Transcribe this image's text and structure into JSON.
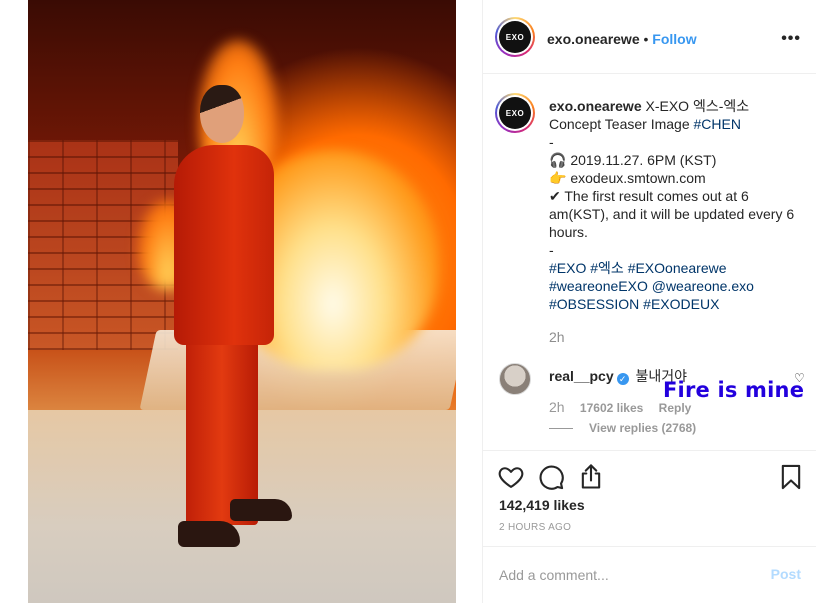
{
  "post": {
    "username": "exo.onearewe",
    "follow_label": "Follow",
    "separator": "•",
    "more_label": "•••",
    "avatar_text": "EXO"
  },
  "caption": {
    "username": "exo.onearewe",
    "line1": " X-EXO 엑스-엑소 Concept Teaser Image ",
    "tag_chen": "#CHEN",
    "dash1": "-",
    "line_date": "🎧 2019.11.27. 6PM (KST)",
    "line_site": "👉 exodeux.smtown.com",
    "line_result": "✔ The first result comes out at 6 am(KST), and it will be updated every 6 hours.",
    "dash2": "-",
    "tag_exo": "#EXO",
    "tag_kr": "#엑소",
    "tag_onearewe": "#EXOonearewe",
    "tag_weareone": "#weareoneEXO",
    "mention": "@weareone.exo",
    "tag_obsession": "#OBSESSION",
    "tag_exodeux": "#EXODEUX",
    "time": "2h"
  },
  "comment": {
    "username": "real__pcy",
    "verified": "✓",
    "text": "불내거야",
    "time": "2h",
    "likes": "17602 likes",
    "reply_label": "Reply",
    "view_replies": "View replies (2768)",
    "overlay": "Fire is mine"
  },
  "actions": {
    "likes": "142,419 likes",
    "posted": "2 HOURS AGO"
  },
  "comment_box": {
    "placeholder": "Add a comment...",
    "post_label": "Post"
  }
}
